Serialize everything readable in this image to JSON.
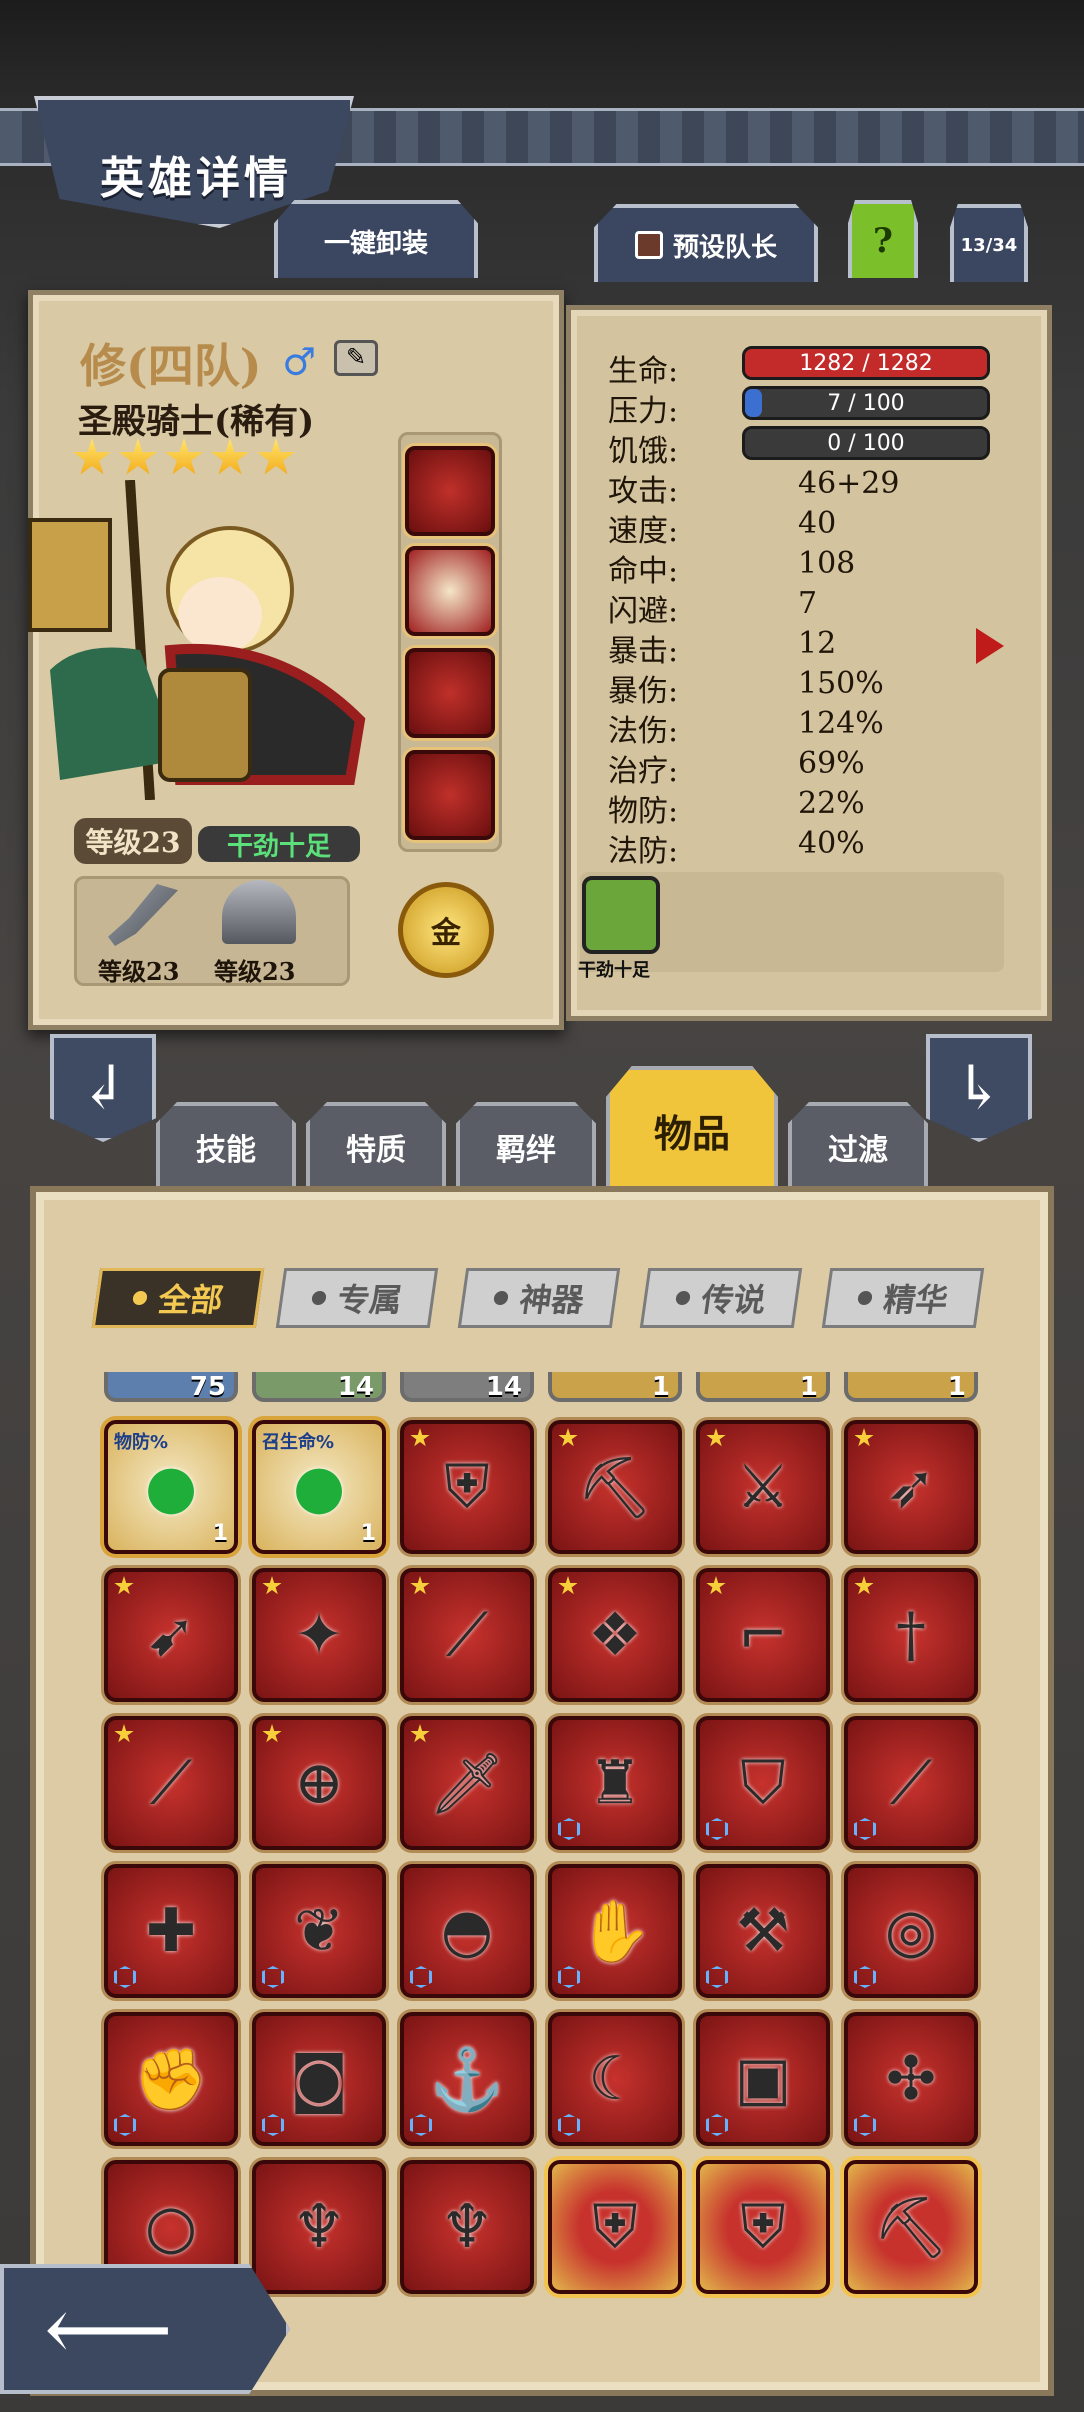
{
  "header": {
    "title": "英雄详情"
  },
  "top_buttons": {
    "unequip_all": "一键卸装",
    "preset_leader": "预设队长",
    "help": "?",
    "page_counter": "13/34"
  },
  "hero": {
    "name": "修(四队)",
    "class": "圣殿骑士(稀有)",
    "stars": 5,
    "level_label": "等级23",
    "mood": "干劲十足",
    "weapon_level": "等级23",
    "armor_level": "等级23",
    "gold_label": "金"
  },
  "stats": {
    "health": {
      "label": "生命:",
      "value": "1282 / 1282",
      "fraction": 1.0,
      "color": "#c32a2a"
    },
    "stress": {
      "label": "压力:",
      "value": "7 / 100",
      "fraction": 0.07,
      "color": "#3b6fd0"
    },
    "hunger": {
      "label": "饥饿:",
      "value": "0 / 100",
      "fraction": 0.0,
      "color": "#555555"
    },
    "rows": [
      {
        "label": "攻击:",
        "value": "46+29"
      },
      {
        "label": "速度:",
        "value": "40"
      },
      {
        "label": "命中:",
        "value": "108"
      },
      {
        "label": "闪避:",
        "value": "7"
      },
      {
        "label": "暴击:",
        "value": "12"
      },
      {
        "label": "暴伤:",
        "value": "150%"
      },
      {
        "label": "法伤:",
        "value": "124%"
      },
      {
        "label": "治疗:",
        "value": "69%"
      },
      {
        "label": "物防:",
        "value": "22%"
      },
      {
        "label": "法防:",
        "value": "40%"
      }
    ],
    "trait_label": "干劲十足"
  },
  "tabs": [
    {
      "label": "技能"
    },
    {
      "label": "特质"
    },
    {
      "label": "羁绊"
    },
    {
      "label": "物品"
    },
    {
      "label": "过滤"
    }
  ],
  "filters": [
    {
      "label": "全部"
    },
    {
      "label": "专属"
    },
    {
      "label": "神器"
    },
    {
      "label": "传说"
    },
    {
      "label": "精华"
    }
  ],
  "partial_row": [
    {
      "count": "75"
    },
    {
      "count": "14"
    },
    {
      "count": "14"
    },
    {
      "count": "1"
    },
    {
      "count": "1"
    },
    {
      "count": "1"
    }
  ],
  "items": [
    {
      "tag": "物防%",
      "count": "1",
      "kind": "green",
      "icon": "gem-icon"
    },
    {
      "tag": "召生命%",
      "count": "1",
      "kind": "green",
      "icon": "gem-icon"
    },
    {
      "kind": "star",
      "icon": "shield-icon"
    },
    {
      "kind": "star",
      "icon": "pickaxe-icon"
    },
    {
      "kind": "star",
      "icon": "crossed-blades-icon"
    },
    {
      "kind": "star",
      "icon": "crossbow-icon"
    },
    {
      "kind": "star",
      "icon": "bow-icon"
    },
    {
      "kind": "star",
      "icon": "flame-staff-icon"
    },
    {
      "kind": "star",
      "icon": "katana-icon"
    },
    {
      "kind": "star",
      "icon": "spellbook-icon"
    },
    {
      "kind": "star",
      "icon": "pistol-icon"
    },
    {
      "kind": "star",
      "icon": "rapier-icon"
    },
    {
      "kind": "star",
      "icon": "cane-icon"
    },
    {
      "kind": "star",
      "icon": "orb-staff-icon"
    },
    {
      "kind": "star",
      "icon": "longsword-icon"
    },
    {
      "kind": "hex",
      "icon": "cape-icon"
    },
    {
      "kind": "hex",
      "icon": "crest-shield-icon"
    },
    {
      "kind": "hex",
      "icon": "red-blade-icon"
    },
    {
      "kind": "hex",
      "icon": "greatsword-icon"
    },
    {
      "kind": "hex",
      "icon": "leaf-blade-icon"
    },
    {
      "kind": "hex",
      "icon": "helmet-icon"
    },
    {
      "kind": "hex",
      "icon": "gauntlet-icon"
    },
    {
      "kind": "hex",
      "icon": "axe-icon"
    },
    {
      "kind": "hex",
      "icon": "ring-icon"
    },
    {
      "kind": "hex",
      "icon": "glove-icon"
    },
    {
      "kind": "hex",
      "icon": "belt-icon"
    },
    {
      "kind": "hex",
      "icon": "hook-icon"
    },
    {
      "kind": "hex",
      "icon": "claw-icon"
    },
    {
      "kind": "hex",
      "icon": "tome-icon"
    },
    {
      "kind": "hex",
      "icon": "shuriken-icon"
    },
    {
      "kind": "plain",
      "icon": "bracelet-icon"
    },
    {
      "kind": "plain",
      "icon": "goblet-icon"
    },
    {
      "kind": "plain",
      "icon": "goblet-icon"
    },
    {
      "kind": "gold",
      "icon": "shield-icon"
    },
    {
      "kind": "gold",
      "icon": "shield-icon"
    },
    {
      "kind": "gold",
      "icon": "pickaxe-icon"
    }
  ]
}
